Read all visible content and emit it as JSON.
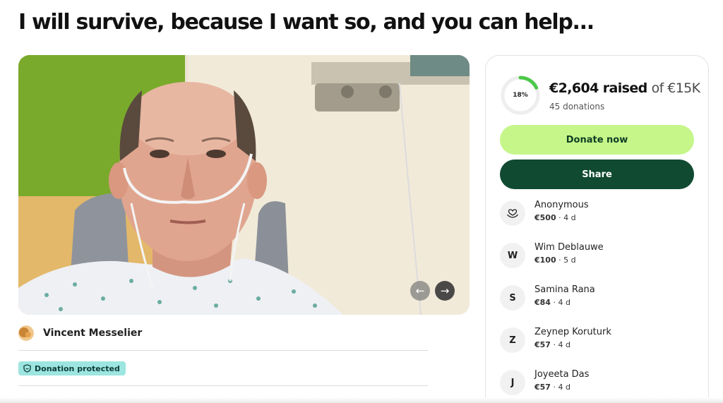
{
  "page": {
    "title": "I will survive, because I want so, and you can help..."
  },
  "gallery": {
    "prev_icon": "←",
    "next_icon": "→",
    "icons": [
      "arrow-left-icon",
      "arrow-right-icon"
    ]
  },
  "organizer": {
    "name": "Vincent Messelier"
  },
  "protection": {
    "label": "Donation protected",
    "icon": "shield-icon",
    "color": "#9ce5e0"
  },
  "fundraiser": {
    "progress_percent": 18,
    "progress_label": "18%",
    "raised_amount": "€2,604 raised",
    "goal_text": "of €15K",
    "donation_count_text": "45 donations",
    "donate_label": "Donate now",
    "share_label": "Share",
    "colors": {
      "progress": "#4cc84a",
      "donate_button": "#c6f68a",
      "share_button": "#0f4a31"
    }
  },
  "donors": [
    {
      "name": "Anonymous",
      "initial": "",
      "icon": "heart-hand-icon",
      "amount": "€500",
      "time": "4 d"
    },
    {
      "name": "Wim Deblauwe",
      "initial": "W",
      "amount": "€100",
      "time": "5 d"
    },
    {
      "name": "Samina Rana",
      "initial": "S",
      "amount": "€84",
      "time": "4 d"
    },
    {
      "name": "Zeynep Koruturk",
      "initial": "Z",
      "amount": "€57",
      "time": "4 d"
    },
    {
      "name": "Joyeeta Das",
      "initial": "J",
      "amount": "€57",
      "time": "4 d"
    }
  ]
}
